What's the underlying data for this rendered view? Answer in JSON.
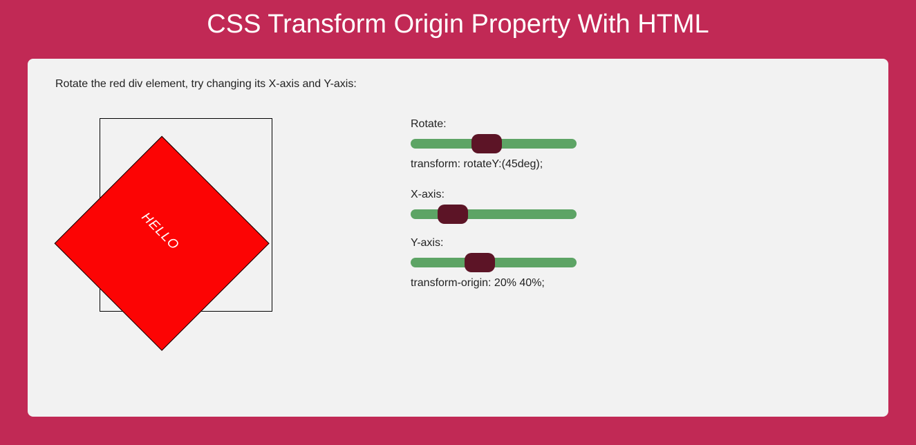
{
  "page": {
    "title": "CSS Transform Origin Property With HTML"
  },
  "panel": {
    "instruction": "Rotate the red div element, try changing its X-axis and Y-axis:",
    "demo_text": "HELLO"
  },
  "controls": {
    "rotate": {
      "label": "Rotate:",
      "value": 45,
      "min": 0,
      "max": 100,
      "output": "transform: rotateY:(45deg);"
    },
    "x_axis": {
      "label": "X-axis:",
      "value": 20,
      "min": 0,
      "max": 100
    },
    "y_axis": {
      "label": "Y-axis:",
      "value": 40,
      "min": 0,
      "max": 100,
      "output": "transform-origin: 20% 40%;"
    }
  }
}
